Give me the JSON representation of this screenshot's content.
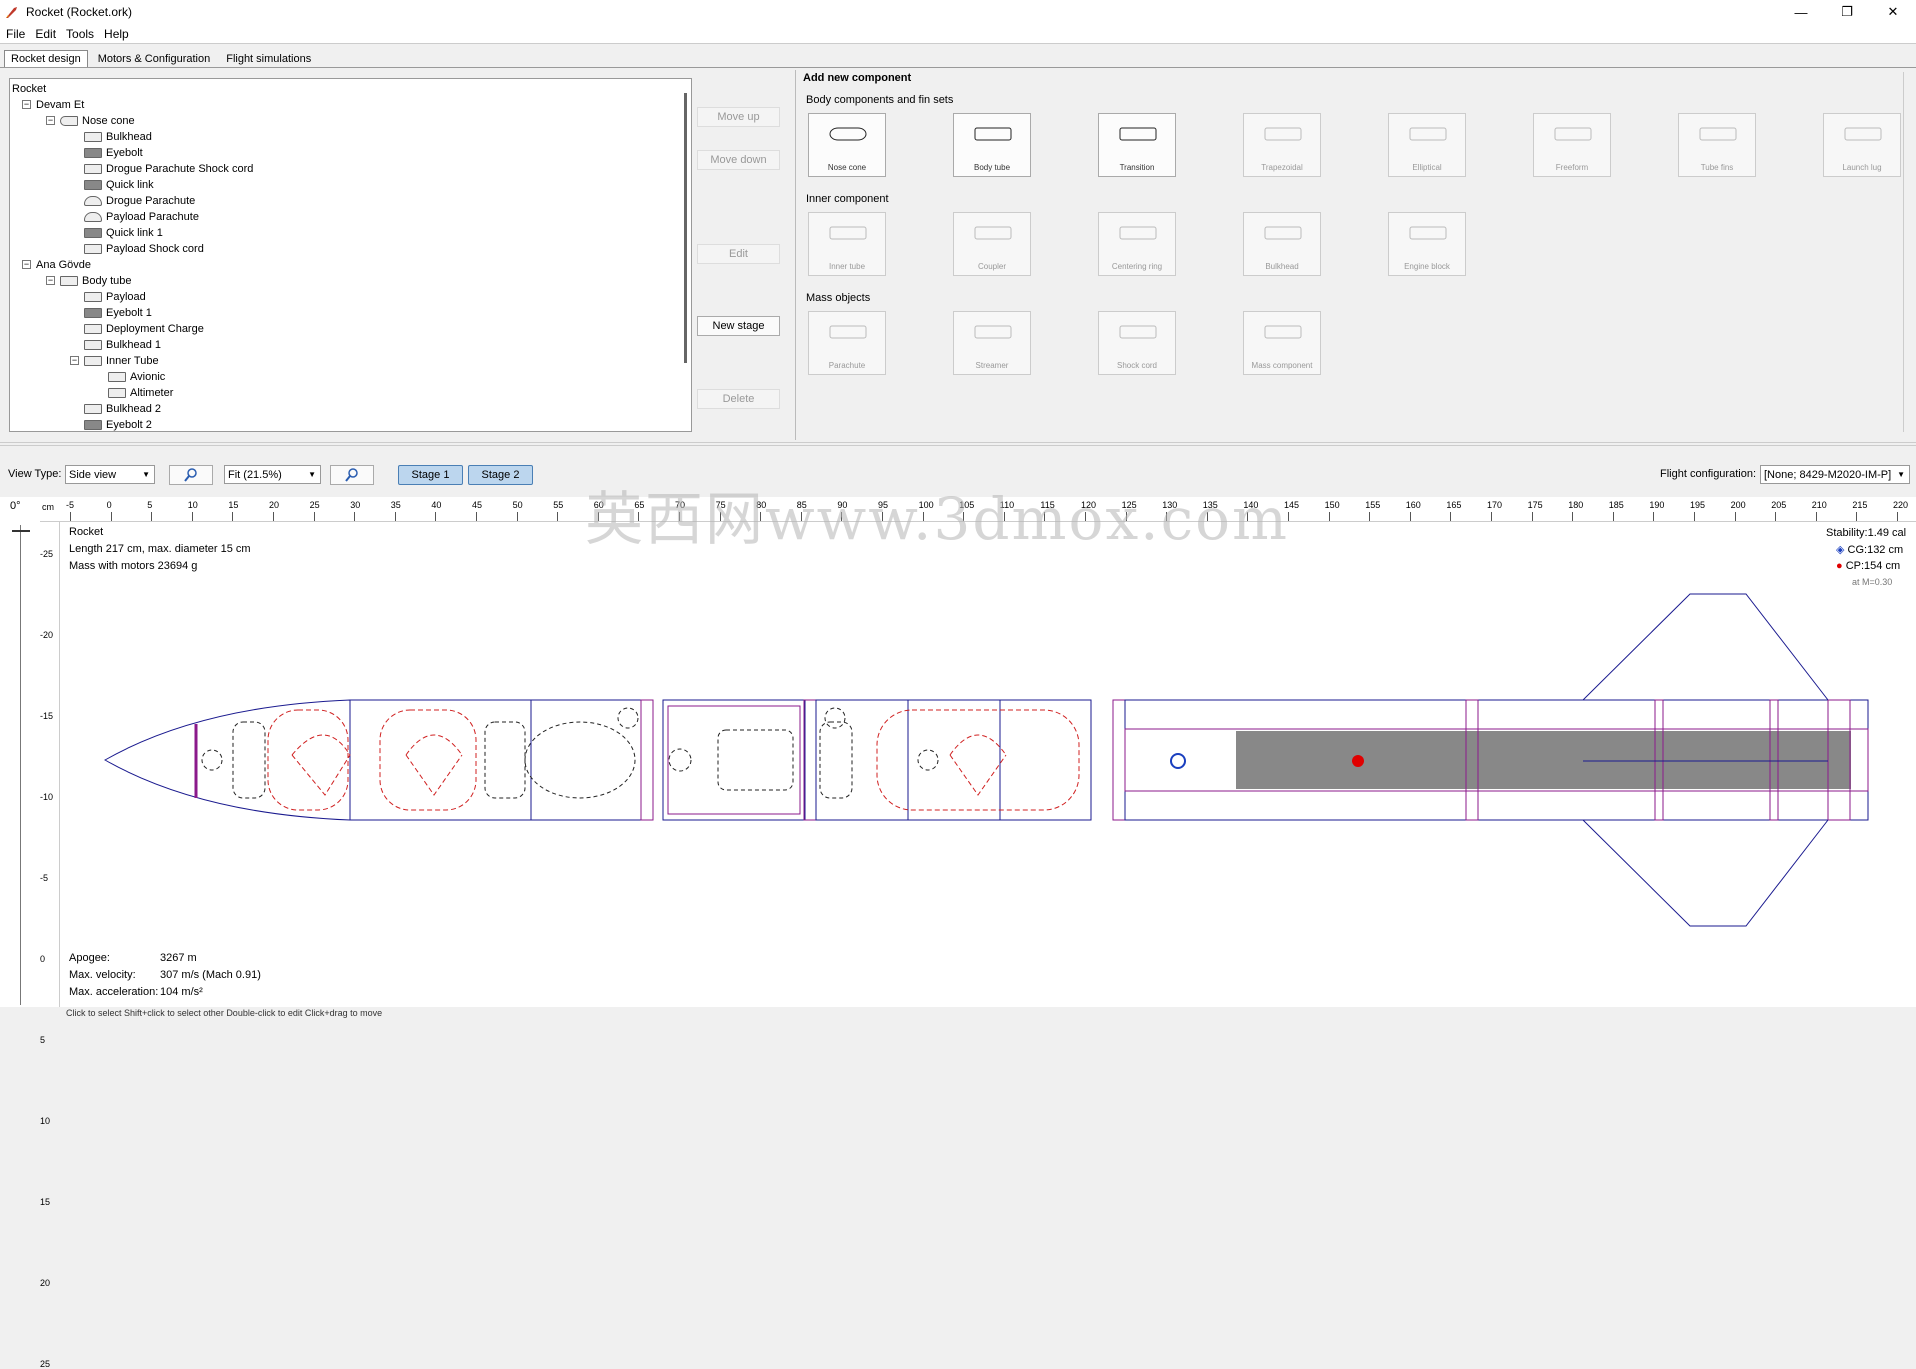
{
  "window": {
    "title": "Rocket (Rocket.ork)",
    "controls": [
      "—",
      "❐",
      "✕"
    ]
  },
  "menu": [
    "File",
    "Edit",
    "Tools",
    "Help"
  ],
  "tabs": [
    "Rocket design",
    "Motors & Configuration",
    "Flight simulations"
  ],
  "tree": {
    "root": "Rocket",
    "items": [
      {
        "label": "Devam Et",
        "level": 0,
        "icon": "stage-icon",
        "expander": "−"
      },
      {
        "label": "Nose cone",
        "level": 1,
        "icon": "nose-cone-icon",
        "expander": "−"
      },
      {
        "label": "Bulkhead",
        "level": 2,
        "icon": "bulkhead-icon"
      },
      {
        "label": "Eyebolt",
        "level": 2,
        "icon": "mass-icon"
      },
      {
        "label": "Drogue Parachute Shock cord",
        "level": 2,
        "icon": "shock-cord-icon"
      },
      {
        "label": "Quick link",
        "level": 2,
        "icon": "mass-icon"
      },
      {
        "label": "Drogue Parachute",
        "level": 2,
        "icon": "parachute-icon"
      },
      {
        "label": "Payload Parachute",
        "level": 2,
        "icon": "parachute-icon"
      },
      {
        "label": "Quick link 1",
        "level": 2,
        "icon": "mass-icon"
      },
      {
        "label": "Payload Shock cord",
        "level": 2,
        "icon": "shock-cord-icon"
      },
      {
        "label": "Ana Gövde",
        "level": 0,
        "icon": "stage-icon",
        "expander": "−"
      },
      {
        "label": "Body tube",
        "level": 1,
        "icon": "body-tube-icon",
        "expander": "−"
      },
      {
        "label": "Payload",
        "level": 2,
        "icon": "payload-icon"
      },
      {
        "label": "Eyebolt 1",
        "level": 2,
        "icon": "mass-icon"
      },
      {
        "label": "Deployment Charge",
        "level": 2,
        "icon": "charge-icon"
      },
      {
        "label": "Bulkhead 1",
        "level": 2,
        "icon": "bulkhead-icon"
      },
      {
        "label": "Inner Tube",
        "level": 2,
        "icon": "inner-tube-icon",
        "expander": "−"
      },
      {
        "label": "Avionic",
        "level": 3,
        "icon": "avionic-icon"
      },
      {
        "label": "Altimeter",
        "level": 3,
        "icon": "altimeter-icon"
      },
      {
        "label": "Bulkhead 2",
        "level": 2,
        "icon": "bulkhead-icon"
      },
      {
        "label": "Eyebolt 2",
        "level": 2,
        "icon": "mass-icon"
      }
    ]
  },
  "side_buttons": [
    {
      "label": "Move up",
      "enabled": false
    },
    {
      "label": "Move down",
      "enabled": false
    },
    {
      "label": "Edit",
      "enabled": false
    },
    {
      "label": "New stage",
      "enabled": true
    },
    {
      "label": "Delete",
      "enabled": false
    }
  ],
  "add_component": {
    "title": "Add new component",
    "groups": [
      {
        "label": "Body components and fin sets",
        "items": [
          {
            "label": "Nose cone",
            "enabled": true,
            "icon": "nose-cone-icon"
          },
          {
            "label": "Body tube",
            "enabled": true,
            "icon": "body-tube-icon"
          },
          {
            "label": "Transition",
            "enabled": true,
            "icon": "transition-icon"
          },
          {
            "label": "Trapezoidal",
            "enabled": false,
            "icon": "trapezoidal-fin-icon"
          },
          {
            "label": "Elliptical",
            "enabled": false,
            "icon": "elliptical-fin-icon"
          },
          {
            "label": "Freeform",
            "enabled": false,
            "icon": "freeform-fin-icon"
          },
          {
            "label": "Tube fins",
            "enabled": false,
            "icon": "tube-fins-icon"
          },
          {
            "label": "Launch lug",
            "enabled": false,
            "icon": "launch-lug-icon"
          }
        ]
      },
      {
        "label": "Inner component",
        "items": [
          {
            "label": "Inner tube",
            "enabled": false,
            "icon": "inner-tube-icon"
          },
          {
            "label": "Coupler",
            "enabled": false,
            "icon": "coupler-icon"
          },
          {
            "label": "Centering ring",
            "enabled": false,
            "icon": "centering-ring-icon"
          },
          {
            "label": "Bulkhead",
            "enabled": false,
            "icon": "bulkhead-icon"
          },
          {
            "label": "Engine block",
            "enabled": false,
            "icon": "engine-block-icon"
          }
        ]
      },
      {
        "label": "Mass objects",
        "items": [
          {
            "label": "Parachute",
            "enabled": false,
            "icon": "parachute-icon"
          },
          {
            "label": "Streamer",
            "enabled": false,
            "icon": "streamer-icon"
          },
          {
            "label": "Shock cord",
            "enabled": false,
            "icon": "shock-cord-icon"
          },
          {
            "label": "Mass component",
            "enabled": false,
            "icon": "mass-component-icon"
          }
        ]
      }
    ]
  },
  "view": {
    "view_type_label": "View Type:",
    "view_type_value": "Side view",
    "zoom_value": "Fit (21.5%)",
    "stages": [
      "Stage 1",
      "Stage 2"
    ],
    "flight_config_label": "Flight configuration:",
    "flight_config_value": "[None; 8429-M2020-IM-P]",
    "angle": "0°",
    "ruler_unit": "cm"
  },
  "ruler_top": [
    "-5",
    "0",
    "5",
    "10",
    "15",
    "20",
    "25",
    "30",
    "35",
    "40",
    "45",
    "50",
    "55",
    "60",
    "65",
    "70",
    "75",
    "80",
    "85",
    "90",
    "95",
    "100",
    "105",
    "110",
    "115",
    "120",
    "125",
    "130",
    "135",
    "140",
    "145",
    "150",
    "155",
    "160",
    "165",
    "170",
    "175",
    "180",
    "185",
    "190",
    "195",
    "200",
    "205",
    "210",
    "215",
    "220"
  ],
  "ruler_left": [
    "-25",
    "-20",
    "-15",
    "-10",
    "-5",
    "0",
    "5",
    "10",
    "15",
    "20",
    "25"
  ],
  "rocket_info": {
    "name": "Rocket",
    "length": "Length 217 cm, max. diameter 15 cm",
    "mass": "Mass with motors 23694 g"
  },
  "stability": {
    "stability": "Stability:1.49 cal",
    "cg": "CG:132 cm",
    "cp": "CP:154 cm",
    "mach": "at M=0.30",
    "cg_color": "#1a3fbf",
    "cp_color": "#e00000"
  },
  "flight": {
    "apogee_label": "Apogee:",
    "apogee_value": "3267 m",
    "velocity_label": "Max. velocity:",
    "velocity_value": "307 m/s  (Mach 0.91)",
    "accel_label": "Max. acceleration:",
    "accel_value": "104 m/s²"
  },
  "status_bar": "Click to select    Shift+click to select other    Double-click to edit    Click+drag to move",
  "watermark": "英西网www.3dmox.com"
}
